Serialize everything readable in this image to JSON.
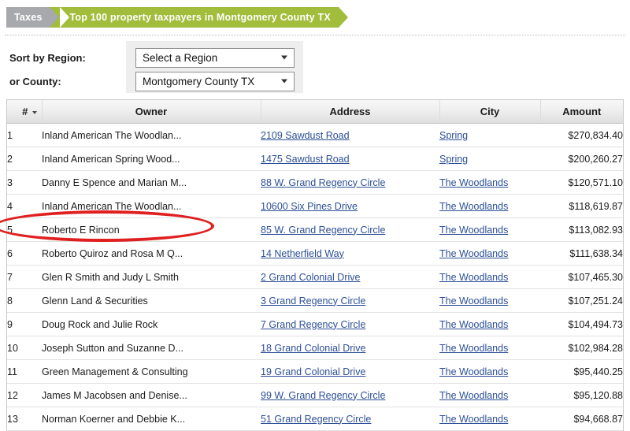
{
  "breadcrumb": {
    "section": "Taxes",
    "title": "Top 100 property taxpayers in Montgomery County TX",
    "section_color": "#a7a9ac",
    "title_color": "#a2bd3b"
  },
  "filters": {
    "region": {
      "label": "Sort by Region:",
      "value": "Select a Region"
    },
    "county": {
      "label": "or County:",
      "value": "Montgomery County TX"
    }
  },
  "table": {
    "columns": {
      "num": "#",
      "owner": "Owner",
      "address": "Address",
      "city": "City",
      "amount": "Amount"
    },
    "sorted_by": "#",
    "sort_direction": "desc",
    "rows": [
      {
        "num": "1",
        "owner": "Inland American The Woodlan...",
        "address": "2109 Sawdust Road",
        "city": "Spring",
        "amount": "$270,834.40"
      },
      {
        "num": "2",
        "owner": "Inland American Spring Wood...",
        "address": "1475 Sawdust Road",
        "city": "Spring",
        "amount": "$200,260.27"
      },
      {
        "num": "3",
        "owner": "Danny E Spence and Marian M...",
        "address": "88 W. Grand Regency Circle",
        "city": "The Woodlands",
        "amount": "$120,571.10"
      },
      {
        "num": "4",
        "owner": "Inland American The Woodlan...",
        "address": "10600 Six Pines Drive",
        "city": "The Woodlands",
        "amount": "$118,619.87"
      },
      {
        "num": "5",
        "owner": "Roberto E Rincon",
        "address": "85 W. Grand Regency Circle",
        "city": "The Woodlands",
        "amount": "$113,082.93"
      },
      {
        "num": "6",
        "owner": "Roberto Quiroz and Rosa M Q...",
        "address": "14 Netherfield Way",
        "city": "The Woodlands",
        "amount": "$111,638.34"
      },
      {
        "num": "7",
        "owner": "Glen R Smith and Judy L Smith",
        "address": "2 Grand Colonial Drive",
        "city": "The Woodlands",
        "amount": "$107,465.30"
      },
      {
        "num": "8",
        "owner": "Glenn Land & Securities",
        "address": "3 Grand Regency Circle",
        "city": "The Woodlands",
        "amount": "$107,251.24"
      },
      {
        "num": "9",
        "owner": "Doug Rock and Julie Rock",
        "address": "7 Grand Regency Circle",
        "city": "The Woodlands",
        "amount": "$104,494.73"
      },
      {
        "num": "10",
        "owner": "Joseph Sutton and Suzanne D...",
        "address": "18 Grand Colonial Drive",
        "city": "The Woodlands",
        "amount": "$102,984.28"
      },
      {
        "num": "11",
        "owner": "Green Management & Consulting",
        "address": "19 Grand Colonial Drive",
        "city": "The Woodlands",
        "amount": "$95,440.25"
      },
      {
        "num": "12",
        "owner": "James M Jacobsen and Denise...",
        "address": "99 W. Grand Regency Circle",
        "city": "The Woodlands",
        "amount": "$95,120.88"
      },
      {
        "num": "13",
        "owner": "Norman Koerner and Debbie K...",
        "address": "51 Grand Regency Circle",
        "city": "The Woodlands",
        "amount": "$94,668.87"
      }
    ]
  },
  "annotation": {
    "shape": "ellipse",
    "color": "#e02020",
    "highlights_row": "5"
  }
}
